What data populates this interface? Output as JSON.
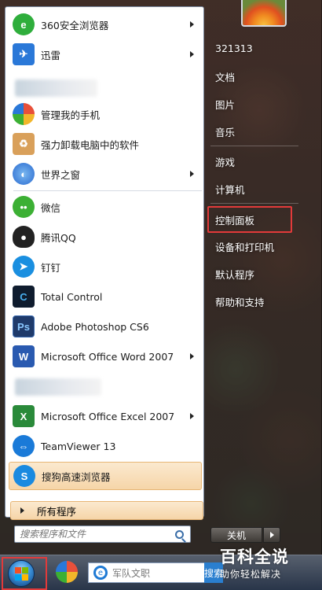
{
  "left_pane": {
    "items": [
      {
        "label": "360安全浏览器",
        "icon": "browser-360-icon",
        "color": "#2fae3c",
        "has_arrow": true
      },
      {
        "label": "迅雷",
        "icon": "thunder-icon",
        "color": "#2a78d8",
        "has_arrow": true
      },
      {
        "label": "管理我的手机",
        "icon": "phone-manager-icon",
        "color": "#e8503a",
        "has_arrow": false
      },
      {
        "label": "强力卸载电脑中的软件",
        "icon": "uninstaller-icon",
        "color": "#d08a2a",
        "has_arrow": false
      },
      {
        "label": "世界之窗",
        "icon": "theworld-icon",
        "color": "#2a6ad0",
        "has_arrow": true
      },
      {
        "label": "微信",
        "icon": "wechat-icon",
        "color": "#3cb034",
        "has_arrow": false
      },
      {
        "label": "腾讯QQ",
        "icon": "qq-icon",
        "color": "#222222",
        "has_arrow": false
      },
      {
        "label": "钉钉",
        "icon": "dingtalk-icon",
        "color": "#1a8fe0",
        "has_arrow": false
      },
      {
        "label": "Total Control",
        "icon": "total-control-icon",
        "color": "#0f1c2e",
        "has_arrow": false
      },
      {
        "label": "Adobe Photoshop CS6",
        "icon": "photoshop-icon",
        "color": "#1f3a6a",
        "has_arrow": false
      },
      {
        "label": "Microsoft Office Word 2007",
        "icon": "word-icon",
        "color": "#2a5ab0",
        "has_arrow": true
      },
      {
        "label": "Microsoft Office Excel 2007",
        "icon": "excel-icon",
        "color": "#2a8a3a",
        "has_arrow": true
      },
      {
        "label": "TeamViewer 13",
        "icon": "teamviewer-icon",
        "color": "#1a7ad8",
        "has_arrow": false
      },
      {
        "label": "搜狗高速浏览器",
        "icon": "sogou-browser-icon",
        "color": "#1a8ae0",
        "has_arrow": false
      }
    ],
    "all_programs": "所有程序",
    "search_placeholder": "搜索程序和文件"
  },
  "right_pane": {
    "items": [
      "321313",
      "文档",
      "图片",
      "音乐",
      "游戏",
      "计算机",
      "控制面板",
      "设备和打印机",
      "默认程序",
      "帮助和支持"
    ],
    "shutdown_label": "关机"
  },
  "taskbar": {
    "search_placeholder": "军队文职",
    "search_button": "搜索"
  },
  "watermark": {
    "title": "百科全说",
    "subtitle": "助你轻松解决"
  },
  "colors": {
    "highlight_border": "#e23a3a",
    "menu_item_highlight": "#f6d5a8"
  }
}
